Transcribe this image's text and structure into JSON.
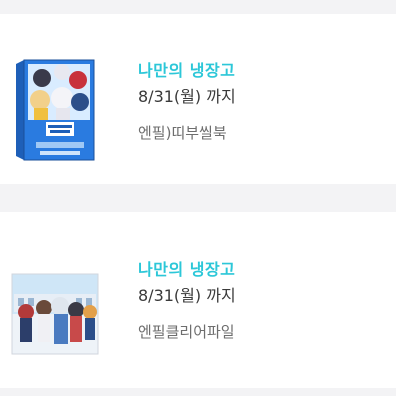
{
  "items": [
    {
      "store_name": "나만의 냉장고",
      "deadline": "8/31(월) 까지",
      "product_name": "엔필)띠부씰북",
      "thumbnail": "sticker-book-box-image"
    },
    {
      "store_name": "나만의 냉장고",
      "deadline": "8/31(월) 까지",
      "product_name": "엔필클리어파일",
      "thumbnail": "clear-file-image"
    }
  ]
}
